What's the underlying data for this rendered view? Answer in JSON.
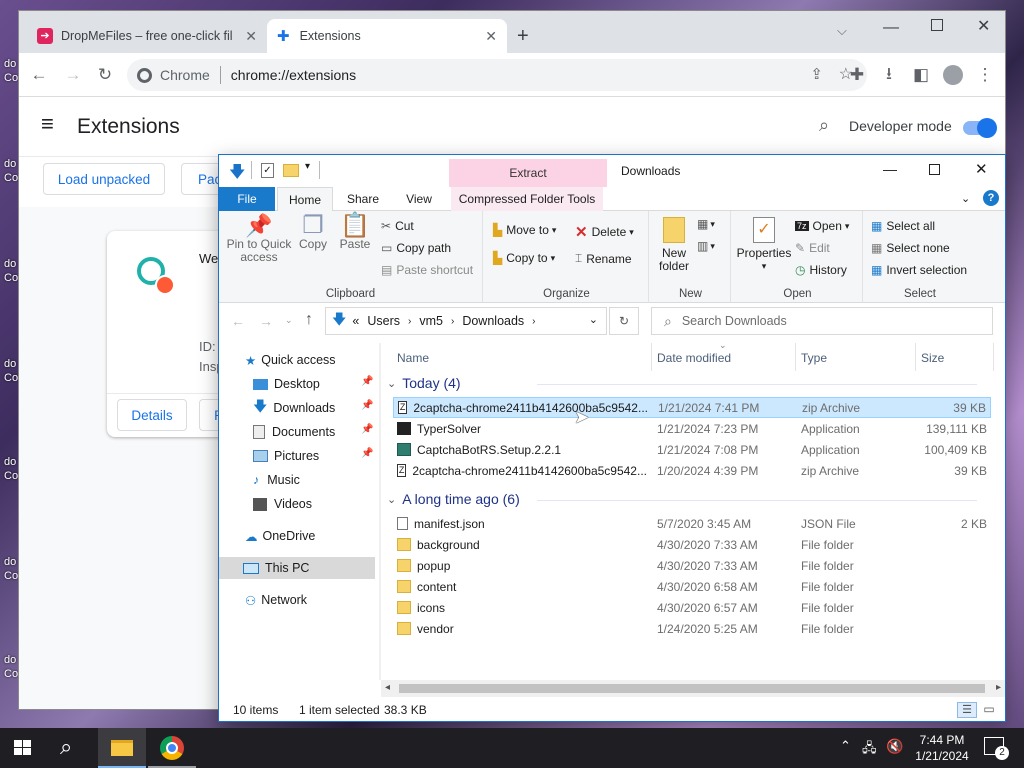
{
  "desktop": {
    "labels": [
      "do",
      "Co",
      "do",
      "Co",
      "do",
      "Co",
      "do",
      "Co",
      "do",
      "Co",
      "do",
      "Co",
      "do",
      "Co"
    ]
  },
  "chrome": {
    "tabs": [
      {
        "label": "DropMeFiles – free one-click file"
      },
      {
        "label": "Extensions"
      }
    ],
    "omnibox": {
      "site": "Chrome",
      "url": "chrome://extensions"
    },
    "page_title": "Extensions",
    "developer_mode_label": "Developer mode",
    "developer_mode_on": true,
    "load_unpacked": "Load unpacked",
    "pack_partial": "Pac",
    "card": {
      "title_partial": "Wel",
      "id_label": "ID:",
      "inspect_partial": "Insp",
      "details": "Details",
      "remove_partial": "R"
    }
  },
  "explorer": {
    "title": "Downloads",
    "context_tab": "Extract",
    "tabs": [
      "File",
      "Home",
      "Share",
      "View",
      "Compressed Folder Tools"
    ],
    "ribbon": {
      "clipboard": {
        "pin": "Pin to Quick access",
        "copy": "Copy",
        "paste": "Paste",
        "cut": "Cut",
        "copy_path": "Copy path",
        "paste_shortcut": "Paste shortcut",
        "label": "Clipboard"
      },
      "organize": {
        "move_to": "Move to",
        "copy_to": "Copy to",
        "delete": "Delete",
        "rename": "Rename",
        "label": "Organize"
      },
      "new": {
        "new_folder": "New folder",
        "label": "New"
      },
      "open": {
        "properties": "Properties",
        "open": "Open",
        "edit": "Edit",
        "history": "History",
        "label": "Open"
      },
      "select": {
        "select_all": "Select all",
        "select_none": "Select none",
        "invert": "Invert selection",
        "label": "Select"
      }
    },
    "address": {
      "overflow": "«",
      "crumbs": [
        "Users",
        "vm5",
        "Downloads"
      ],
      "search_placeholder": "Search Downloads"
    },
    "nav": {
      "quick_access": "Quick access",
      "items": [
        "Desktop",
        "Downloads",
        "Documents",
        "Pictures",
        "Music",
        "Videos"
      ],
      "onedrive": "OneDrive",
      "this_pc": "This PC",
      "network": "Network"
    },
    "columns": {
      "name": "Name",
      "date": "Date modified",
      "type": "Type",
      "size": "Size"
    },
    "groups": [
      {
        "label": "Today (4)",
        "files": [
          {
            "name": "2captcha-chrome2411b4142600ba5c9542...",
            "date": "1/21/2024 7:41 PM",
            "type": "zip Archive",
            "size": "39 KB",
            "icon": "zip-icon",
            "selected": true
          },
          {
            "name": "TyperSolver",
            "date": "1/21/2024 7:23 PM",
            "type": "Application",
            "size": "139,111 KB",
            "icon": "app-icon",
            "selected": false
          },
          {
            "name": "CaptchaBotRS.Setup.2.2.1",
            "date": "1/21/2024 7:08 PM",
            "type": "Application",
            "size": "100,409 KB",
            "icon": "setup-icon",
            "selected": false
          },
          {
            "name": "2captcha-chrome2411b4142600ba5c9542...",
            "date": "1/20/2024 4:39 PM",
            "type": "zip Archive",
            "size": "39 KB",
            "icon": "zip-icon",
            "selected": false
          }
        ]
      },
      {
        "label": "A long time ago (6)",
        "files": [
          {
            "name": "manifest.json",
            "date": "5/7/2020 3:45 AM",
            "type": "JSON File",
            "size": "2 KB",
            "icon": "file-icon",
            "selected": false
          },
          {
            "name": "background",
            "date": "4/30/2020 7:33 AM",
            "type": "File folder",
            "size": "",
            "icon": "folder-icon",
            "selected": false
          },
          {
            "name": "popup",
            "date": "4/30/2020 7:33 AM",
            "type": "File folder",
            "size": "",
            "icon": "folder-icon",
            "selected": false
          },
          {
            "name": "content",
            "date": "4/30/2020 6:58 AM",
            "type": "File folder",
            "size": "",
            "icon": "folder-icon",
            "selected": false
          },
          {
            "name": "icons",
            "date": "4/30/2020 6:57 AM",
            "type": "File folder",
            "size": "",
            "icon": "folder-icon",
            "selected": false
          },
          {
            "name": "vendor",
            "date": "1/24/2020 5:25 AM",
            "type": "File folder",
            "size": "",
            "icon": "folder-icon",
            "selected": false
          }
        ]
      }
    ],
    "status": {
      "count": "10 items",
      "selected": "1 item selected",
      "size": "38.3 KB"
    }
  },
  "taskbar": {
    "time": "7:44 PM",
    "date": "1/21/2024",
    "notifications": "2"
  }
}
